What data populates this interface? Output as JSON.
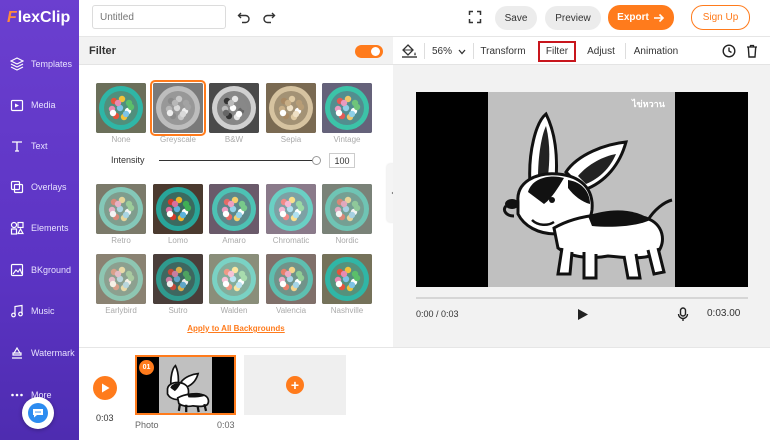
{
  "brand": {
    "logo_f": "F",
    "logo_rest": "lexClip",
    "accent": "#ff7b1c",
    "sidebar_color": "#5c34c4"
  },
  "sidebar": {
    "items": [
      {
        "label": "Templates",
        "icon": "layers-icon"
      },
      {
        "label": "Media",
        "icon": "media-icon"
      },
      {
        "label": "Text",
        "icon": "text-icon"
      },
      {
        "label": "Overlays",
        "icon": "overlays-icon"
      },
      {
        "label": "Elements",
        "icon": "elements-icon"
      },
      {
        "label": "BKground",
        "icon": "background-icon"
      },
      {
        "label": "Music",
        "icon": "music-icon"
      },
      {
        "label": "Watermark",
        "icon": "watermark-icon"
      },
      {
        "label": "More",
        "icon": "more-icon"
      }
    ]
  },
  "topbar": {
    "title_placeholder": "Untitled",
    "save": "Save",
    "preview": "Preview",
    "export": "Export",
    "signup": "Sign Up"
  },
  "panel": {
    "title": "Filter",
    "toggle_on": true,
    "intensity_label": "Intensity",
    "intensity_value": "100",
    "intensity_fraction": 1.0,
    "apply_all": "Apply to All Backgrounds",
    "filters_row1": [
      {
        "name": "None",
        "tone": "color"
      },
      {
        "name": "Greyscale",
        "tone": "grey",
        "selected": true
      },
      {
        "name": "B&W",
        "tone": "bw"
      },
      {
        "name": "Sepia",
        "tone": "sepia"
      },
      {
        "name": "Vintage",
        "tone": "vintage"
      }
    ],
    "filters_row2": [
      {
        "name": "Retro",
        "tone": "retro"
      },
      {
        "name": "Lomo",
        "tone": "lomo"
      },
      {
        "name": "Amaro",
        "tone": "amaro"
      },
      {
        "name": "Chromatic",
        "tone": "chromatic"
      },
      {
        "name": "Nordic",
        "tone": "nordic"
      }
    ],
    "filters_row3": [
      {
        "name": "Earlybird",
        "tone": "earlybird"
      },
      {
        "name": "Sutro",
        "tone": "sutro"
      },
      {
        "name": "Walden",
        "tone": "walden"
      },
      {
        "name": "Valencia",
        "tone": "valencia"
      },
      {
        "name": "Nashville",
        "tone": "nashville"
      }
    ]
  },
  "toolbar": {
    "zoom": "56%",
    "transform": "Transform",
    "filter": "Filter",
    "adjust": "Adjust",
    "animation": "Animation"
  },
  "player": {
    "time": "0:00 / 0:03",
    "duration": "0:03.00",
    "progress_fraction": 0.0,
    "watermark_text": "ไข่หวาน"
  },
  "timeline": {
    "play_time": "0:03",
    "clip_number": "01",
    "clip_label": "Photo",
    "clip_duration": "0:03",
    "add_label": "+"
  }
}
